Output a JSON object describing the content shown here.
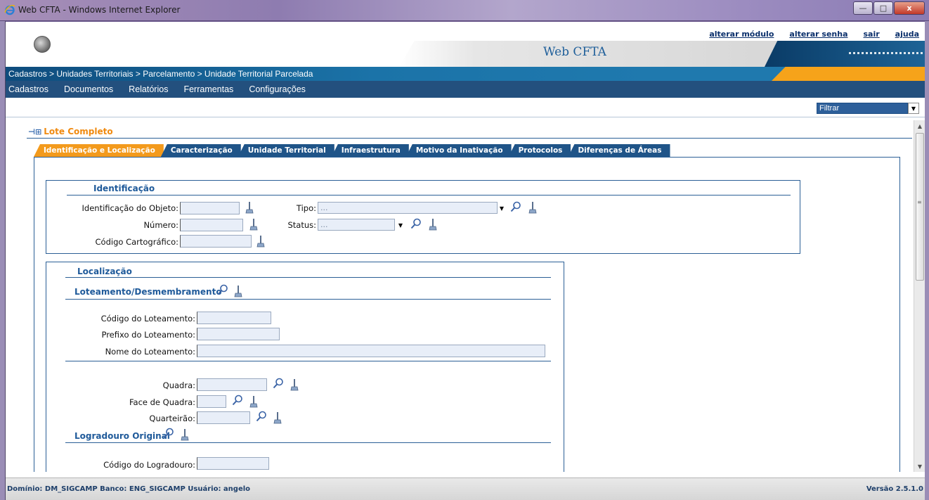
{
  "window": {
    "title": "Web CFTA - Windows Internet Explorer",
    "min_glyph": "—",
    "max_glyph": "□",
    "close_glyph": "x"
  },
  "header": {
    "app_title": "Web CFTA",
    "links": {
      "alterar_modulo": "alterar módulo",
      "alterar_senha": "alterar senha",
      "sair": "sair",
      "ajuda": "ajuda"
    }
  },
  "breadcrumb": "Cadastros > Unidades Territoriais > Parcelamento > Unidade Territorial Parcelada",
  "menu": [
    "Cadastros",
    "Documentos",
    "Relatórios",
    "Ferramentas",
    "Configurações"
  ],
  "filter": {
    "value": "Filtrar"
  },
  "section": {
    "title": "Lote Completo"
  },
  "tabs": [
    {
      "label": "Identificação e Localização",
      "active": true
    },
    {
      "label": "Caracterização",
      "active": false
    },
    {
      "label": "Unidade Territorial",
      "active": false
    },
    {
      "label": "Infraestrutura",
      "active": false
    },
    {
      "label": "Motivo da Inativação",
      "active": false
    },
    {
      "label": "Protocolos",
      "active": false
    },
    {
      "label": "Diferenças de Áreas",
      "active": false
    }
  ],
  "identificacao": {
    "title": "Identificação",
    "id_objeto_label": "Identificação do Objeto:",
    "numero_label": "Número:",
    "codigo_cartografico_label": "Código Cartográfico:",
    "tipo_label": "Tipo:",
    "tipo_value": "...",
    "status_label": "Status:",
    "status_value": "..."
  },
  "localizacao": {
    "title": "Localização",
    "loteamento_title": "Loteamento/Desmembramento",
    "codigo_loteamento_label": "Código do Loteamento:",
    "prefixo_loteamento_label": "Prefixo do Loteamento:",
    "nome_loteamento_label": "Nome do Loteamento:",
    "quadra_label": "Quadra:",
    "face_quadra_label": "Face de Quadra:",
    "quarteirao_label": "Quarteirão:",
    "logradouro_title": "Logradouro Original",
    "codigo_logradouro_label": "Código do Logradouro:"
  },
  "status_bar": {
    "left": "Domínio: DM_SIGCAMP  Banco: ENG_SIGCAMP  Usuário: angelo",
    "right": "Versão 2.5.1.0"
  },
  "colors": {
    "accent_orange": "#f39a1c",
    "nav_blue": "#23507e",
    "link_blue": "#0a2f6b"
  }
}
